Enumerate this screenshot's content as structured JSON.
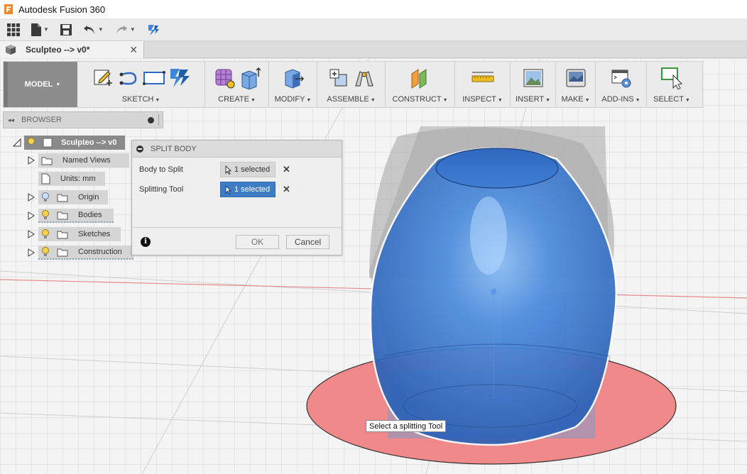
{
  "window": {
    "title": "Autodesk Fusion 360",
    "logo_color": "#f08a24"
  },
  "quick_access": {
    "icons": [
      "grid-icon",
      "file-icon",
      "save-icon",
      "undo-icon",
      "redo-icon",
      "job-status-icon"
    ]
  },
  "document_tab": {
    "label": "Sculpteo --> v0*",
    "close": "✕"
  },
  "ribbon": {
    "workspace": "MODEL",
    "workspace_caret": "▼",
    "groups": [
      {
        "label": "SKETCH",
        "caret": "▼"
      },
      {
        "label": "CREATE",
        "caret": "▼"
      },
      {
        "label": "MODIFY",
        "caret": "▼"
      },
      {
        "label": "ASSEMBLE",
        "caret": "▼"
      },
      {
        "label": "CONSTRUCT",
        "caret": "▼"
      },
      {
        "label": "INSPECT",
        "caret": "▼"
      },
      {
        "label": "INSERT",
        "caret": "▼"
      },
      {
        "label": "MAKE",
        "caret": "▼"
      },
      {
        "label": "ADD-INS",
        "caret": "▼"
      },
      {
        "label": "SELECT",
        "caret": "▼"
      }
    ]
  },
  "browser": {
    "header": "BROWSER",
    "collapse": "◂◂",
    "root": "Sculpteo --> v0",
    "items": [
      {
        "label": "Named Views"
      },
      {
        "label": "Units: mm"
      },
      {
        "label": "Origin"
      },
      {
        "label": "Bodies"
      },
      {
        "label": "Sketches"
      },
      {
        "label": "Construction"
      }
    ]
  },
  "dialog": {
    "title": "SPLIT BODY",
    "rows": [
      {
        "label": "Body to Split",
        "value": "1 selected",
        "clear": "✕"
      },
      {
        "label": "Splitting Tool",
        "value": "1 selected",
        "clear": "✕"
      }
    ],
    "info": "i",
    "ok": "OK",
    "cancel": "Cancel"
  },
  "tooltip": "Select a splitting Tool",
  "colors": {
    "body_blue": "#3d78d0",
    "plane_red": "#f08a8a",
    "active_selection": "#3e7dc5",
    "workspace_gray": "#8d8d8d"
  }
}
